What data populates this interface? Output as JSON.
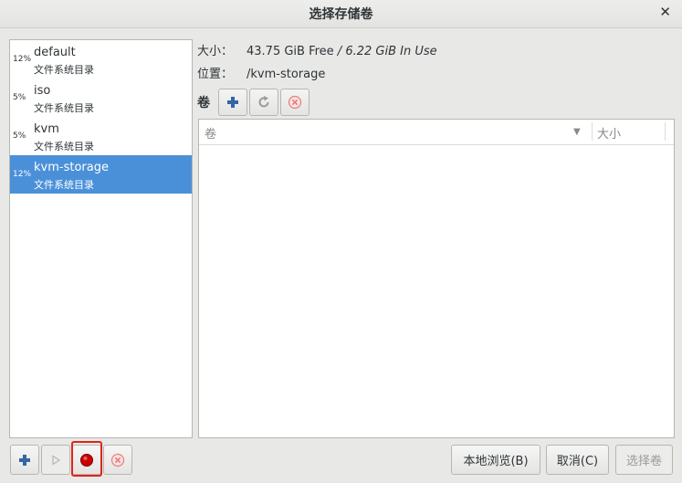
{
  "window": {
    "title": "选择存储卷",
    "close_icon": "✕"
  },
  "pools": [
    {
      "percent": "12%",
      "name": "default",
      "type": "文件系统目录",
      "selected": false
    },
    {
      "percent": "5%",
      "name": "iso",
      "type": "文件系统目录",
      "selected": false
    },
    {
      "percent": "5%",
      "name": "kvm",
      "type": "文件系统目录",
      "selected": false
    },
    {
      "percent": "12%",
      "name": "kvm-storage",
      "type": "文件系统目录",
      "selected": true
    }
  ],
  "details": {
    "size_label": "大小：",
    "size_free": "43.75 GiB Free",
    "size_sep": " / ",
    "size_used": "6.22 GiB In Use",
    "location_label": "位置：",
    "location_value": "/kvm-storage"
  },
  "volumes": {
    "label": "卷",
    "columns": {
      "name": "卷",
      "size": "大小"
    },
    "rows": []
  },
  "buttons": {
    "browse_local": "本地浏览(B)",
    "cancel": "取消(C)",
    "choose_volume": "选择卷"
  },
  "colors": {
    "accent": "#4a90d9",
    "add": "#3465a4",
    "stop": "#cc0000",
    "highlight": "#e2231a"
  }
}
